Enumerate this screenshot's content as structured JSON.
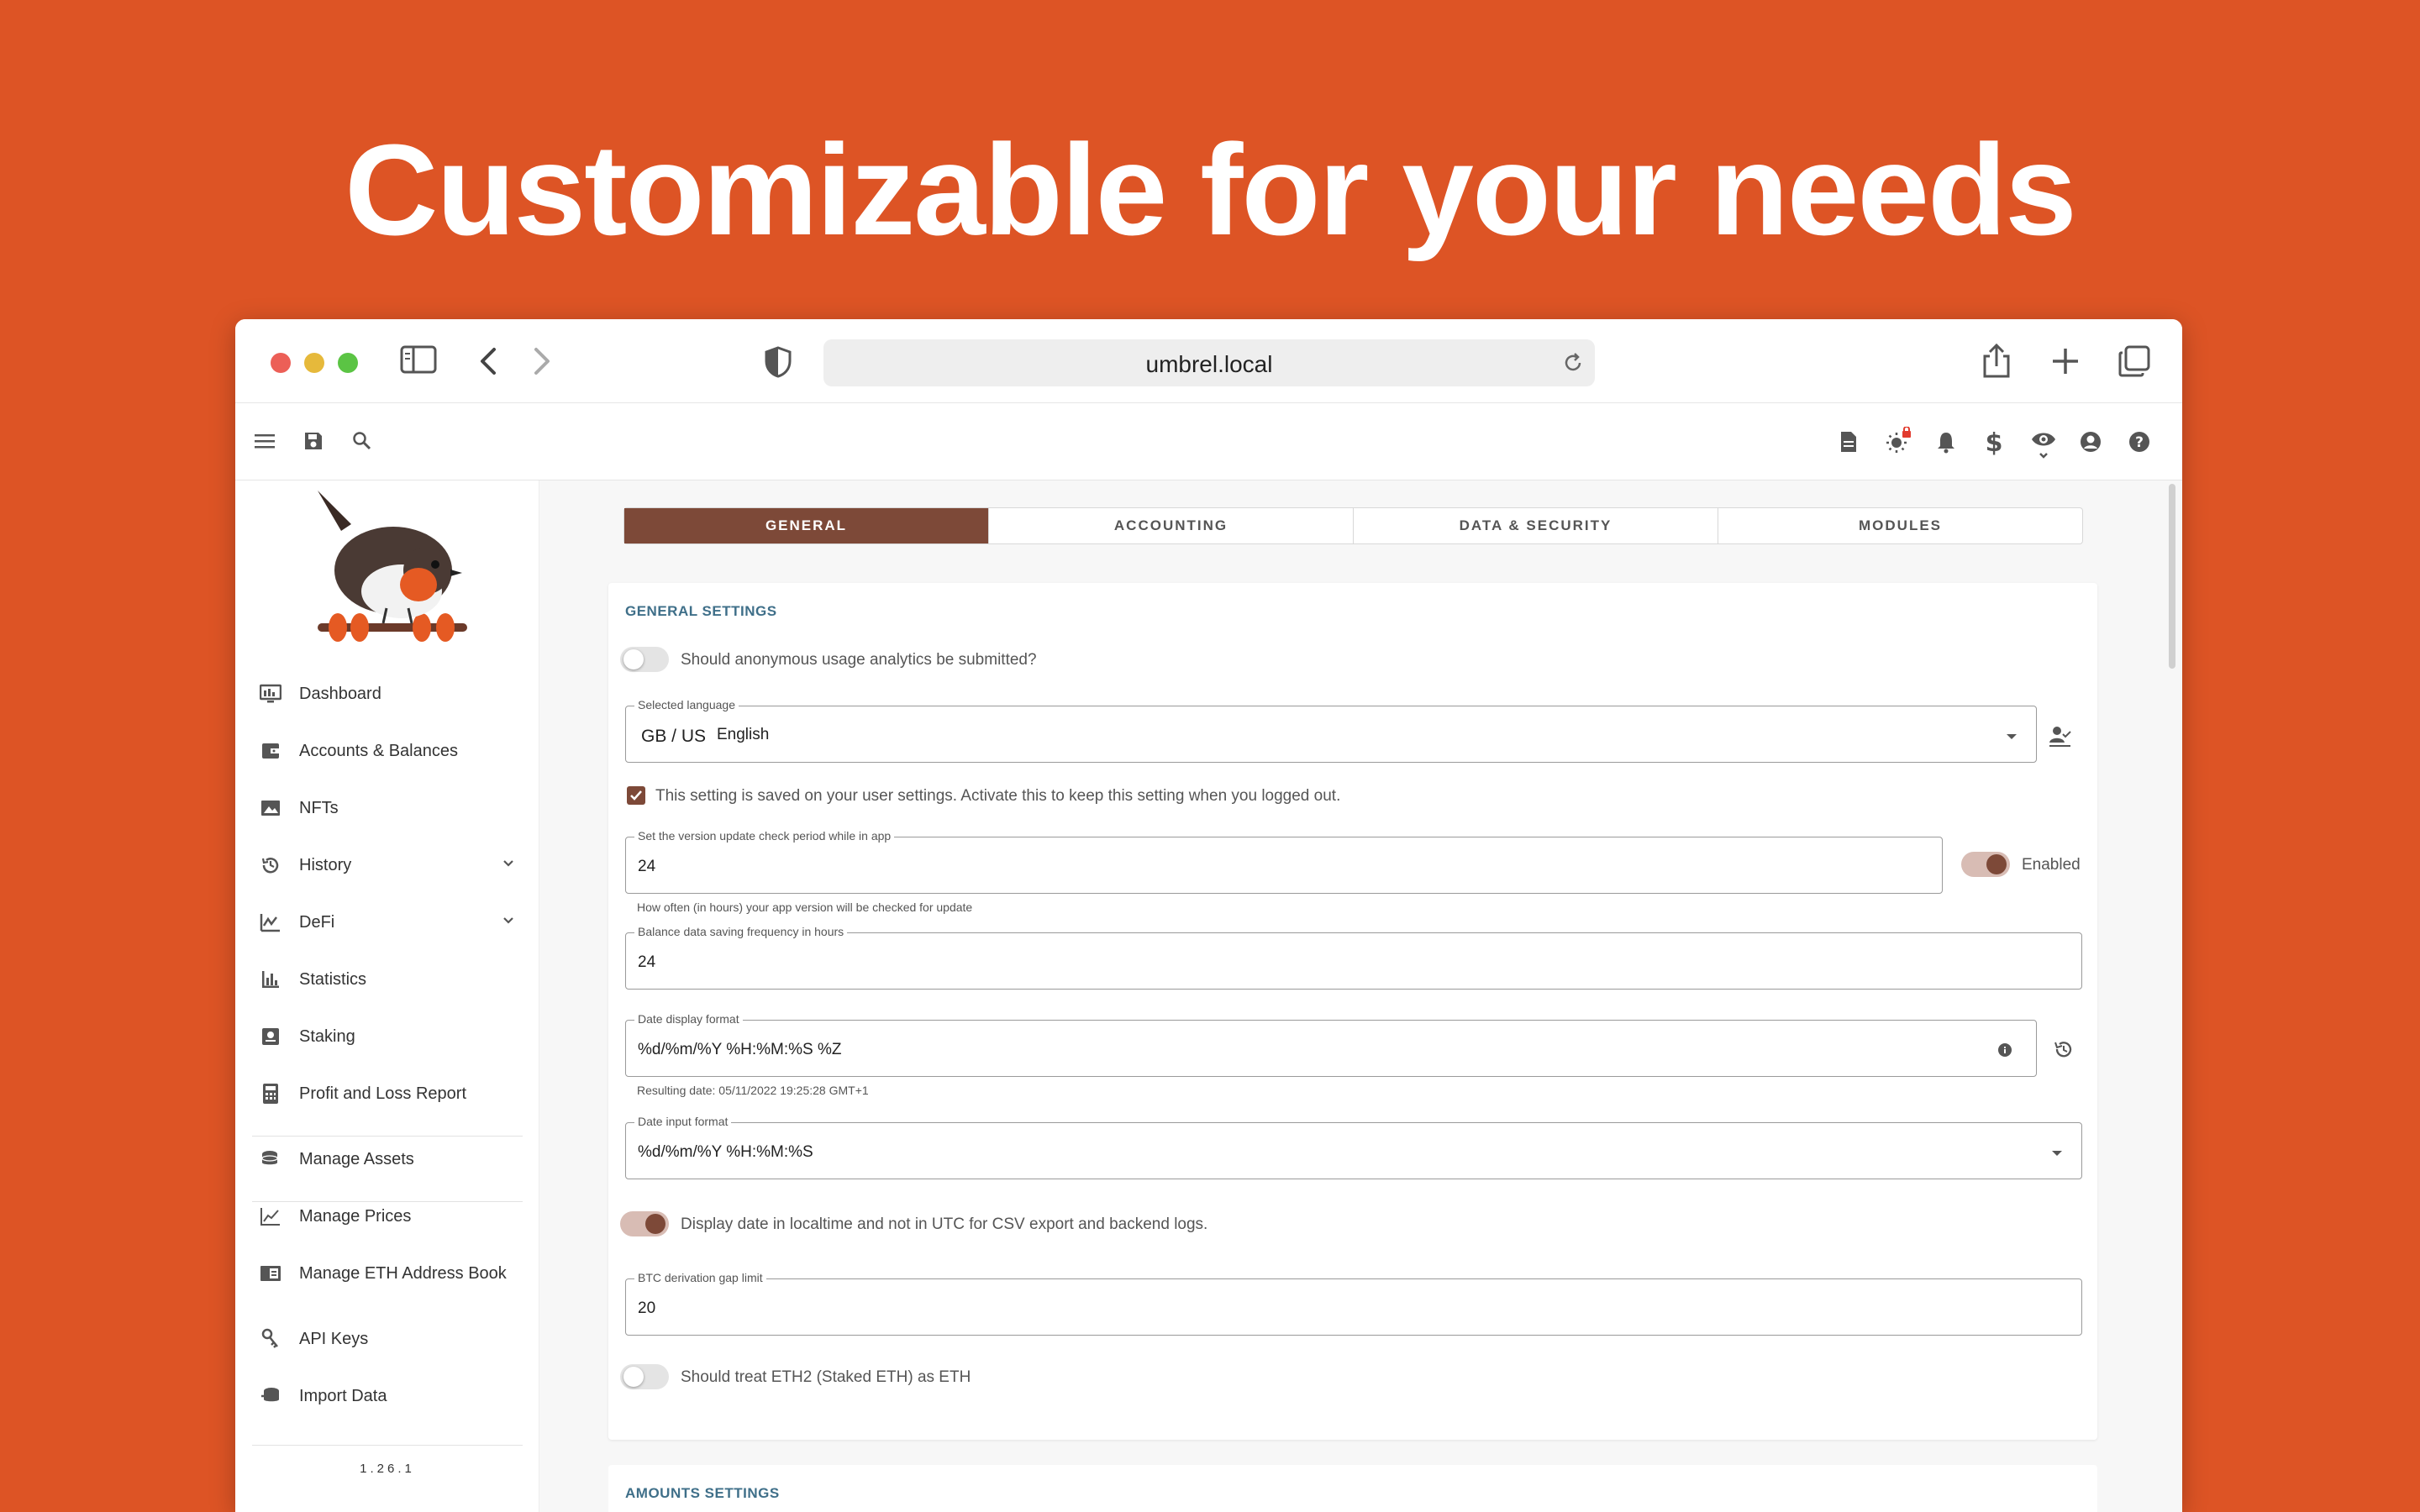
{
  "headline": "Customizable for your needs",
  "browser": {
    "url": "umbrel.local",
    "traffic_colors": [
      "#ec5f57",
      "#e6b93b",
      "#5bc444"
    ]
  },
  "toolbar_left_icons": [
    "menu-icon",
    "save-icon",
    "search-icon"
  ],
  "toolbar_right_icons": [
    "notes-icon",
    "theme-icon",
    "notifications-icon",
    "currency-icon",
    "privacy-icon",
    "account-icon",
    "help-icon"
  ],
  "sidebar": {
    "items": [
      {
        "label": "Dashboard",
        "icon": "dashboard-icon"
      },
      {
        "label": "Accounts & Balances",
        "icon": "wallet-icon"
      },
      {
        "label": "NFTs",
        "icon": "image-icon"
      },
      {
        "label": "History",
        "icon": "history-icon",
        "expandable": true
      },
      {
        "label": "DeFi",
        "icon": "defi-icon",
        "expandable": true
      },
      {
        "label": "Statistics",
        "icon": "bar-chart-icon"
      },
      {
        "label": "Staking",
        "icon": "staking-icon"
      },
      {
        "label": "Profit and Loss Report",
        "icon": "calculator-icon"
      },
      {
        "label": "Manage Assets",
        "icon": "coins-icon"
      },
      {
        "label": "Manage Prices",
        "icon": "line-chart-icon"
      },
      {
        "label": "Manage ETH Address Book",
        "icon": "address-book-icon"
      },
      {
        "label": "API Keys",
        "icon": "key-icon"
      },
      {
        "label": "Import Data",
        "icon": "import-icon"
      }
    ],
    "version": "1.26.1"
  },
  "tabs": [
    {
      "label": "GENERAL",
      "active": true
    },
    {
      "label": "ACCOUNTING",
      "active": false
    },
    {
      "label": "DATA & SECURITY",
      "active": false
    },
    {
      "label": "MODULES",
      "active": false
    }
  ],
  "general": {
    "title": "GENERAL SETTINGS",
    "analytics_label": "Should anonymous usage analytics be submitted?",
    "analytics_enabled": false,
    "language_label": "Selected language",
    "language_flag": "GB / US",
    "language_value": "English",
    "persist_note": "This setting is saved on your user settings. Activate this to keep this setting when you logged out.",
    "persist_checked": true,
    "version_check_label": "Set the version update check period while in app",
    "version_check_value": "24",
    "version_check_hint": "How often (in hours) your app version will be checked for update",
    "version_check_toggle_label": "Enabled",
    "version_check_enabled": true,
    "balance_freq_label": "Balance data saving frequency in hours",
    "balance_freq_value": "24",
    "date_display_label": "Date display format",
    "date_display_value": "%d/%m/%Y %H:%M:%S %Z",
    "date_display_hint": "Resulting date: 05/11/2022 19:25:28 GMT+1",
    "date_input_label": "Date input format",
    "date_input_value": "%d/%m/%Y %H:%M:%S",
    "localtime_label": "Display date in localtime and not in UTC for CSV export and backend logs.",
    "localtime_enabled": true,
    "btc_gap_label": "BTC derivation gap limit",
    "btc_gap_value": "20",
    "eth2_label": "Should treat ETH2 (Staked ETH) as ETH",
    "eth2_enabled": false
  },
  "amounts": {
    "title": "AMOUNTS SETTINGS"
  },
  "colors": {
    "brand_bg": "#DD5425",
    "accent": "#7d4938",
    "section_title": "#3f6f89"
  }
}
